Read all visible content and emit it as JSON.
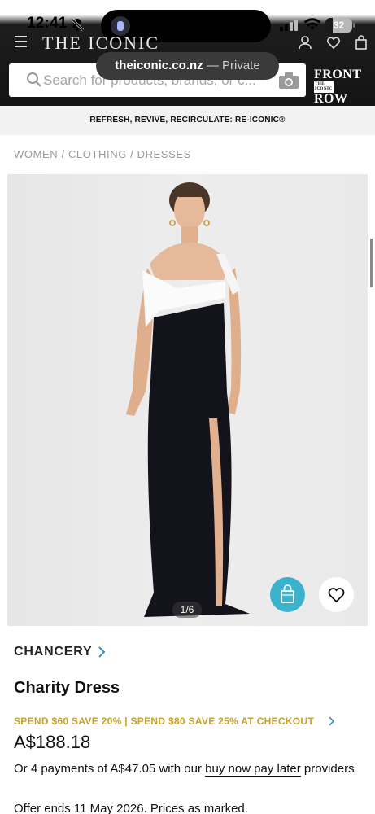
{
  "status_bar": {
    "time": "12:41",
    "battery": "32"
  },
  "header": {
    "logo": "THE ICONIC",
    "url_domain": "theiconic.co.nz",
    "url_suffix": " — Private",
    "search_placeholder": "Search for products, brands, or c...",
    "front_row_line1": "FRONT",
    "front_row_line2": "ROW"
  },
  "promo_banner": "REFRESH, REVIVE, RECIRCULATE: RE-ICONIC®",
  "breadcrumb": [
    "WOMEN",
    "CLOTHING",
    "DRESSES"
  ],
  "gallery": {
    "counter": "1/6"
  },
  "product": {
    "brand": "CHANCERY",
    "name": "Charity Dress",
    "offer": "SPEND $60 SAVE 20% | SPEND $80 SAVE 25% AT CHECKOUT",
    "price": "A$188.18",
    "bnpl_prefix": "Or 4 payments of A$47.05 with our ",
    "bnpl_link": "buy now pay later",
    "bnpl_suffix": " providers",
    "offer_ends": "Offer ends 11 May 2026. Prices as marked."
  },
  "colors": {
    "offer": "#c9a226",
    "bag_button": "#3cb3cc",
    "header_bg": "#141414"
  },
  "icons": [
    "bell-slash-icon",
    "signal-icon",
    "wifi-icon",
    "battery-icon",
    "menu-icon",
    "account-icon",
    "heart-icon",
    "bag-icon",
    "search-icon",
    "camera-icon",
    "chevron-right-icon",
    "shopping-bag-icon",
    "wishlist-heart-icon"
  ]
}
